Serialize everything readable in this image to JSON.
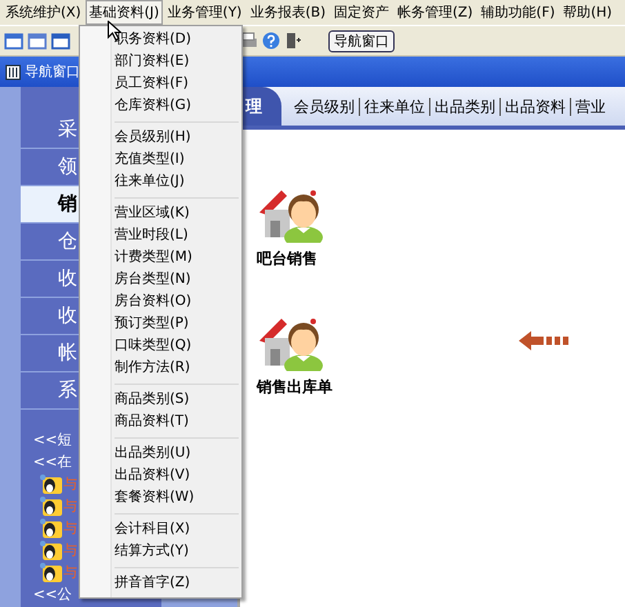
{
  "menu_bar": [
    {
      "label": "系统维护(X)",
      "selected": false
    },
    {
      "label": "基础资料(J)",
      "selected": true
    },
    {
      "label": "业务管理(Y)",
      "selected": false
    },
    {
      "label": "业务报表(B)",
      "selected": false
    },
    {
      "label": "固定资产",
      "selected": false
    },
    {
      "label": "帐务管理(Z)",
      "selected": false
    },
    {
      "label": "辅助功能(F)",
      "selected": false
    },
    {
      "label": "帮助(H)",
      "selected": false
    }
  ],
  "toolbar": {
    "button": "导航窗口"
  },
  "nav_window": {
    "title": "导航窗口"
  },
  "sidebar": {
    "items": [
      {
        "label": "采",
        "selected": false
      },
      {
        "label": "领",
        "selected": false
      },
      {
        "label": "销",
        "selected": true
      },
      {
        "label": "仓",
        "selected": false
      },
      {
        "label": "收",
        "selected": false
      },
      {
        "label": "收",
        "selected": false
      },
      {
        "label": "帐",
        "selected": false
      },
      {
        "label": "系",
        "selected": false
      }
    ],
    "links": [
      "<<短",
      "<<在"
    ],
    "contacts": [
      "与",
      "与",
      "与",
      "与",
      "与"
    ],
    "footer": "<<公"
  },
  "dropdown": {
    "groups": [
      [
        "职务资料(D)",
        "部门资料(E)",
        "员工资料(F)",
        "仓库资料(G)"
      ],
      [
        "会员级别(H)",
        "充值类型(I)",
        "往来单位(J)"
      ],
      [
        "营业区域(K)",
        "营业时段(L)",
        "计费类型(M)",
        "房台类型(N)",
        "房台资料(O)",
        "预订类型(P)",
        "口味类型(Q)",
        "制作方法(R)"
      ],
      [
        "商品类别(S)",
        "商品资料(T)"
      ],
      [
        "出品类别(U)",
        "出品资料(V)",
        "套餐资料(W)"
      ],
      [
        "会计科目(X)",
        "结算方式(Y)"
      ],
      [
        "拼音首字(Z)"
      ]
    ]
  },
  "tab_bar": {
    "tab": "理",
    "links": [
      "会员级别",
      "往来单位",
      "出品类别",
      "出品资料",
      "营业"
    ]
  },
  "shortcuts": [
    {
      "label": "吧台销售"
    },
    {
      "label": "销售出库单"
    }
  ]
}
